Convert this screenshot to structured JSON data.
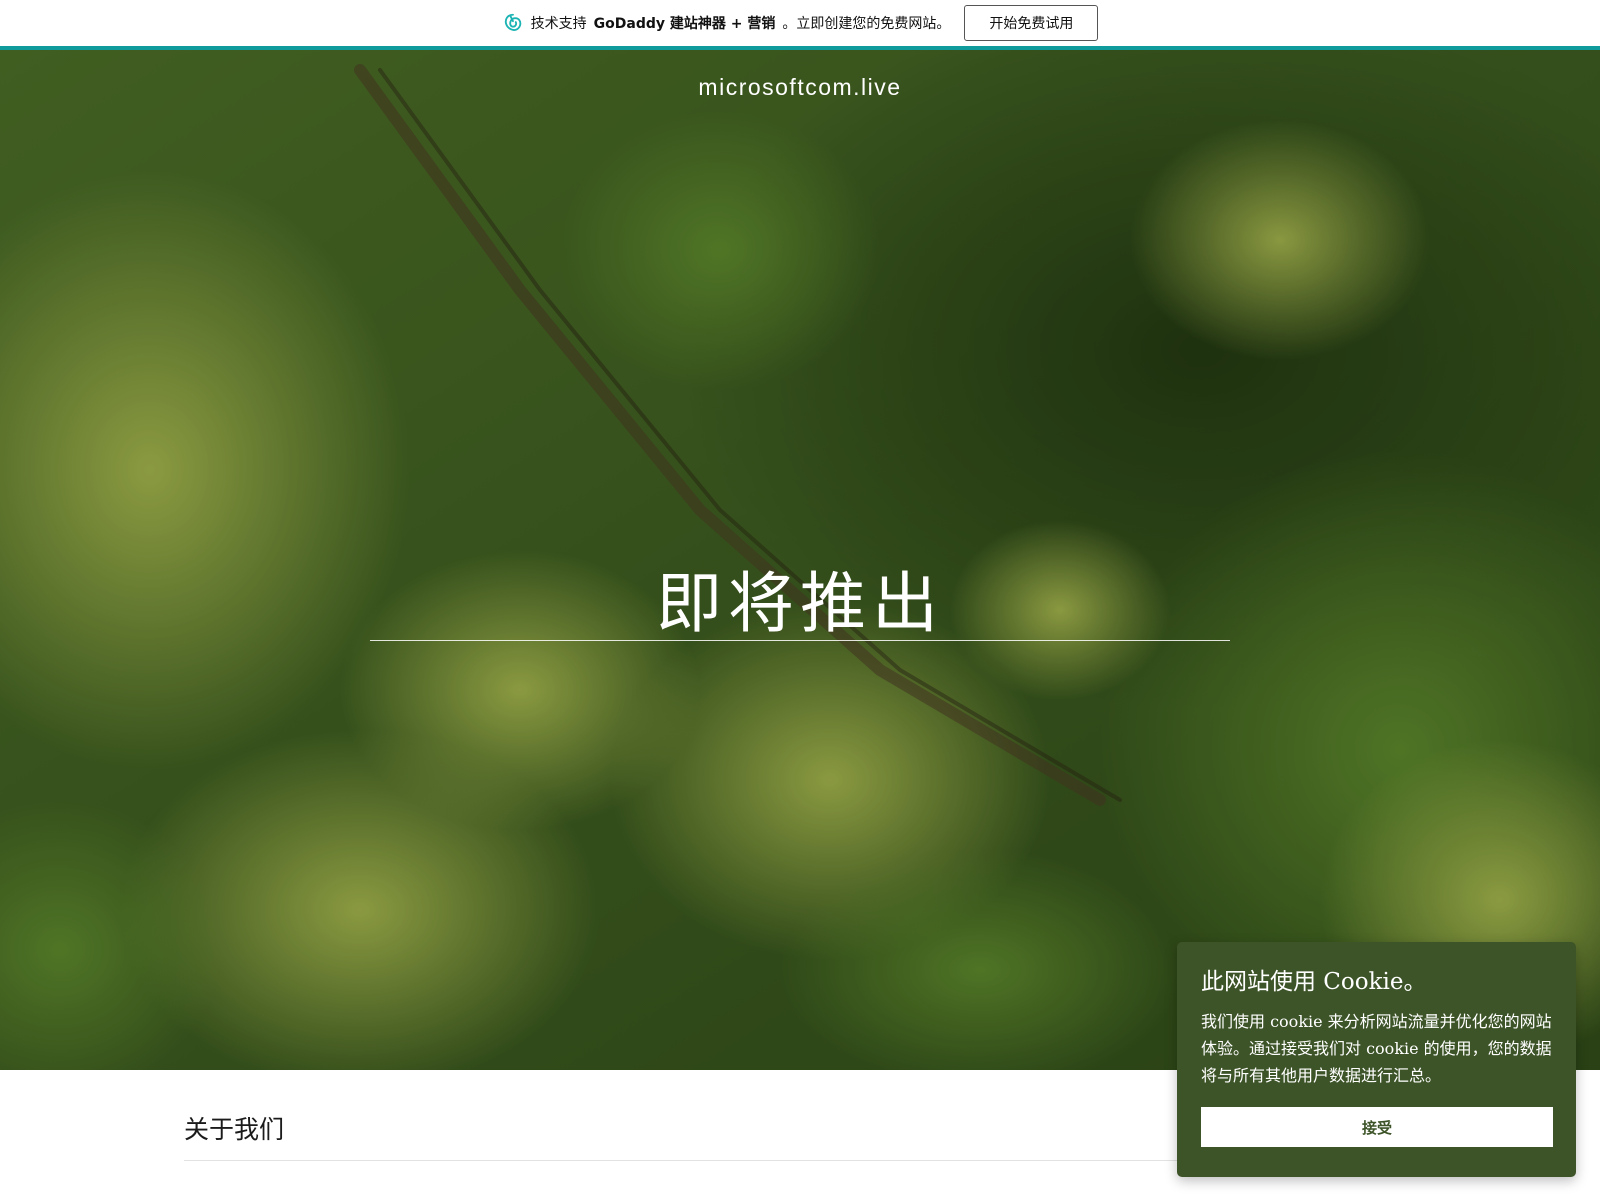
{
  "promo": {
    "logo_icon": "godaddy-logo-icon",
    "text_prefix": "技术支持",
    "text_brand": "GoDaddy 建站神器 + 营销",
    "text_suffix": "。立即创建您的免费网站。",
    "cta_label": "开始免费试用",
    "accent_color": "#0f9b9b"
  },
  "hero": {
    "site_name": "microsoftcom.live",
    "title": "即将推出",
    "background_description_icon": "forest-aerial-image"
  },
  "about": {
    "heading": "关于我们"
  },
  "cookie": {
    "title": "此网站使用 Cookie。",
    "body": "我们使用 cookie 来分析网站流量并优化您的网站体验。通过接受我们对 cookie 的使用，您的数据将与所有其他用户数据进行汇总。",
    "accept_label": "接受",
    "background_color": "#3d5428"
  }
}
